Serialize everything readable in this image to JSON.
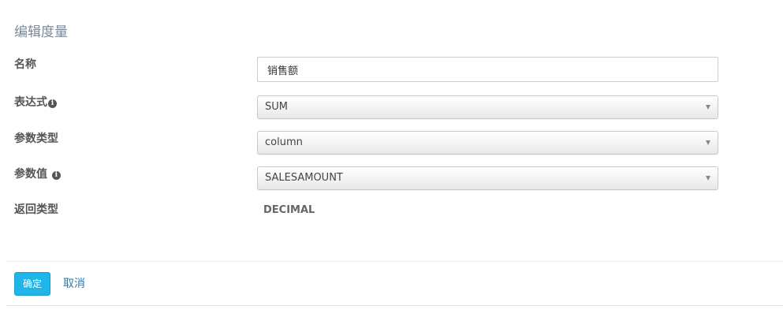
{
  "dialog": {
    "title": "编辑度量"
  },
  "form": {
    "name": {
      "label": "名称",
      "value": "销售额"
    },
    "expression": {
      "label": "表达式",
      "value": "SUM",
      "icon": "info-icon"
    },
    "param_type": {
      "label": "参数类型",
      "value": "column"
    },
    "param_value": {
      "label": "参数值",
      "value": "SALESAMOUNT",
      "icon": "info-icon"
    },
    "return_type": {
      "label": "返回类型",
      "value": "DECIMAL"
    }
  },
  "footer": {
    "confirm_label": "确定",
    "cancel_label": "取消"
  },
  "colors": {
    "primary": "#1fb5e8",
    "link": "#2a7bb8",
    "title": "#7a8a99"
  }
}
